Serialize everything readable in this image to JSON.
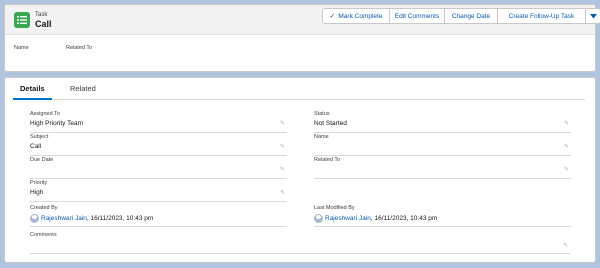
{
  "header": {
    "object_label": "Task",
    "record_title": "Call",
    "icon": "task-list-icon",
    "accent": "#3ba755",
    "buttons": {
      "mark_complete": "Mark Complete",
      "edit_comments": "Edit Comments",
      "change_date": "Change Date",
      "create_follow_up": "Create Follow-Up Task"
    },
    "highlights": {
      "name_label": "Name",
      "related_to_label": "Related To"
    }
  },
  "tabs": [
    {
      "label": "Details",
      "active": true
    },
    {
      "label": "Related",
      "active": false
    }
  ],
  "fields": {
    "assigned_to": {
      "label": "Assigned To",
      "value": "High Priority Team"
    },
    "status": {
      "label": "Status",
      "value": "Not Started"
    },
    "subject": {
      "label": "Subject",
      "value": "Call"
    },
    "name": {
      "label": "Name",
      "value": ""
    },
    "due_date": {
      "label": "Due Date",
      "value": ""
    },
    "related_to": {
      "label": "Related To",
      "value": ""
    },
    "priority": {
      "label": "Priority",
      "value": "High"
    },
    "created_by": {
      "label": "Created By",
      "user": "Rajeshwari Jain",
      "timestamp": ", 16/11/2023, 10:43 pm"
    },
    "last_modified_by": {
      "label": "Last Modified By",
      "user": "Rajeshwari Jain",
      "timestamp": ", 16/11/2023, 10:43 pm"
    },
    "comments": {
      "label": "Comments",
      "value": ""
    }
  },
  "colors": {
    "link": "#0b5cab",
    "tab_active": "#0176d3",
    "background": "#b0c4df"
  }
}
